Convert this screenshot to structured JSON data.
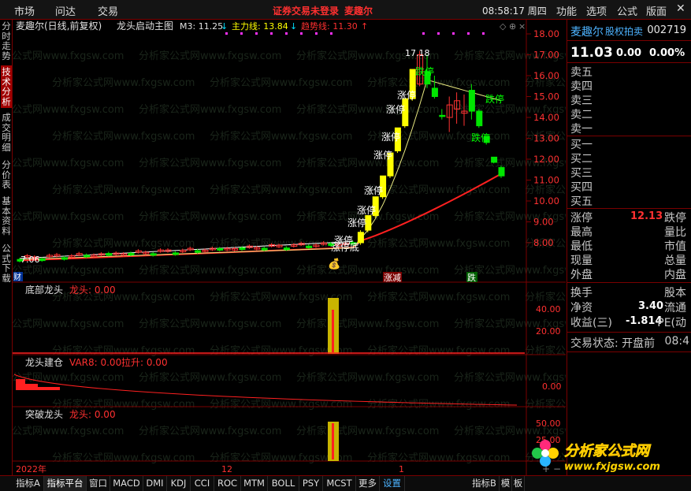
{
  "menu": {
    "items": [
      "市场",
      "问达",
      "交易"
    ],
    "notice": "证券交易未登录",
    "user": "麦趣尔",
    "time": "08:58:17 周四",
    "right": [
      "功能",
      "选项",
      "公式",
      "版面"
    ]
  },
  "left_tabs": [
    "分时走势",
    "技术分析",
    "成交明细",
    "分价表",
    "基本资料",
    "公式下载"
  ],
  "header": {
    "stock": "麦趣尔(日线,前复权)",
    "formula": "龙头启动主图",
    "m3": "M3: 11.25",
    "m3_arrow": "↓",
    "main": "主力线: 13.84",
    "main_arrow": "↓",
    "trend": "趋势线: 11.30",
    "trend_arrow": "↑"
  },
  "price_axis": [
    "18.00",
    "17.00",
    "16.00",
    "15.00",
    "14.00",
    "13.00",
    "12.00",
    "11.00",
    "10.00",
    "9.00",
    "8.00"
  ],
  "annot": {
    "high": "17.18",
    "low": "7.06",
    "zt": "涨停",
    "dt": "跌停",
    "ztd": "涨停底",
    "zhangjian": "涨减",
    "die": "跌",
    "cai": "财"
  },
  "ind1": {
    "name": "底部龙头",
    "label": "龙头: 0.00",
    "axis": [
      "40.00",
      "20.00"
    ]
  },
  "ind2": {
    "name": "龙头建仓",
    "var8": "VAR8: 0.00",
    "lasheng": "拉升: 0.00",
    "axis": [
      "0.00"
    ]
  },
  "ind3": {
    "name": "突破龙头",
    "label": "龙头: 0.00",
    "axis": [
      "50.00",
      "25.00"
    ]
  },
  "date_axis": [
    "2022年",
    "12",
    "1"
  ],
  "quote": {
    "name": "麦趣尔",
    "auction": "股权拍卖",
    "code": "002719",
    "price": "11.03",
    "chg": "0.00",
    "pct": "0.00%",
    "sells": [
      "卖五",
      "卖四",
      "卖三",
      "卖二",
      "卖一"
    ],
    "buys": [
      "买一",
      "买二",
      "买三",
      "买四",
      "买五"
    ],
    "rows": [
      [
        "涨停",
        "12.13",
        "跌停"
      ],
      [
        "最高",
        "",
        "量比"
      ],
      [
        "最低",
        "",
        "市值"
      ],
      [
        "现量",
        "",
        "总量"
      ],
      [
        "外盘",
        "",
        "内盘"
      ]
    ],
    "rows2": [
      [
        "换手",
        "",
        "股本"
      ],
      [
        "净资",
        "3.40",
        "流通"
      ],
      [
        "收益(三)",
        "-1.814",
        "PE(动"
      ]
    ],
    "status": "交易状态: 开盘前",
    "status_time": "08:4"
  },
  "tabs": [
    "指标A",
    "指标平台",
    "窗口",
    "MACD",
    "DMI",
    "KDJ",
    "CCI",
    "ROC",
    "MTM",
    "BOLL",
    "PSY",
    "MCST",
    "更多",
    "设置",
    "指标B",
    "模",
    "板"
  ],
  "watermark": "分析家公式网www.fxgsw.com",
  "logo": {
    "title": "分析家公式网",
    "url": "www.fxjgsw.com"
  },
  "colors": {
    "up": "#ff3232",
    "down": "#00e600",
    "yellow": "#ffff00",
    "frame": "#7a0000"
  }
}
